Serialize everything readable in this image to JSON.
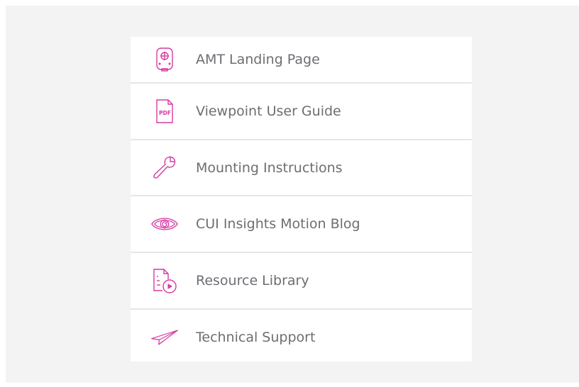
{
  "colors": {
    "accent": "#d63aa3",
    "text": "#6d6d73",
    "background": "#f3f3f3",
    "divider": "#e6e6e6"
  },
  "links": {
    "items": [
      {
        "label": "AMT Landing Page",
        "icon": "motor-icon"
      },
      {
        "label": "Viewpoint User Guide",
        "icon": "pdf-icon"
      },
      {
        "label": "Mounting Instructions",
        "icon": "wrench-icon"
      },
      {
        "label": "CUI Insights Motion Blog",
        "icon": "eye-icon"
      },
      {
        "label": "Resource Library",
        "icon": "video-document-icon"
      },
      {
        "label": "Technical Support",
        "icon": "paper-plane-icon"
      }
    ]
  }
}
